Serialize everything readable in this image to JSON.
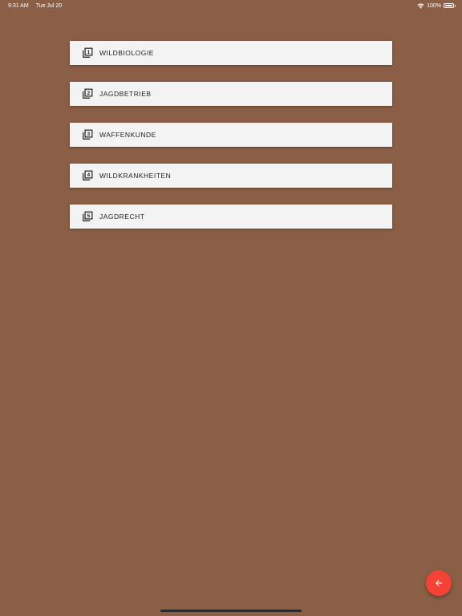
{
  "status_bar": {
    "time": "9:31 AM",
    "date": "Tue Jul 20",
    "battery_text": "100%",
    "battery_level": 1.0,
    "wifi_icon": "wifi-icon",
    "battery_icon": "battery-icon"
  },
  "chapters": [
    {
      "number": "1",
      "label": "WILDBIOLOGIE",
      "icon": "filter-1-icon"
    },
    {
      "number": "2",
      "label": "JAGDBETRIEB",
      "icon": "filter-2-icon"
    },
    {
      "number": "3",
      "label": "WAFFENKUNDE",
      "icon": "filter-3-icon"
    },
    {
      "number": "4",
      "label": "WILDKRANKHEITEN",
      "icon": "filter-4-icon"
    },
    {
      "number": "5",
      "label": "JAGDRECHT",
      "icon": "filter-5-icon"
    }
  ],
  "fab": {
    "icon": "arrow-back-icon"
  },
  "colors": {
    "background": "#8b5f46",
    "card": "#f3f3f4",
    "fab": "#f44336",
    "text": "#1f1f1f"
  }
}
